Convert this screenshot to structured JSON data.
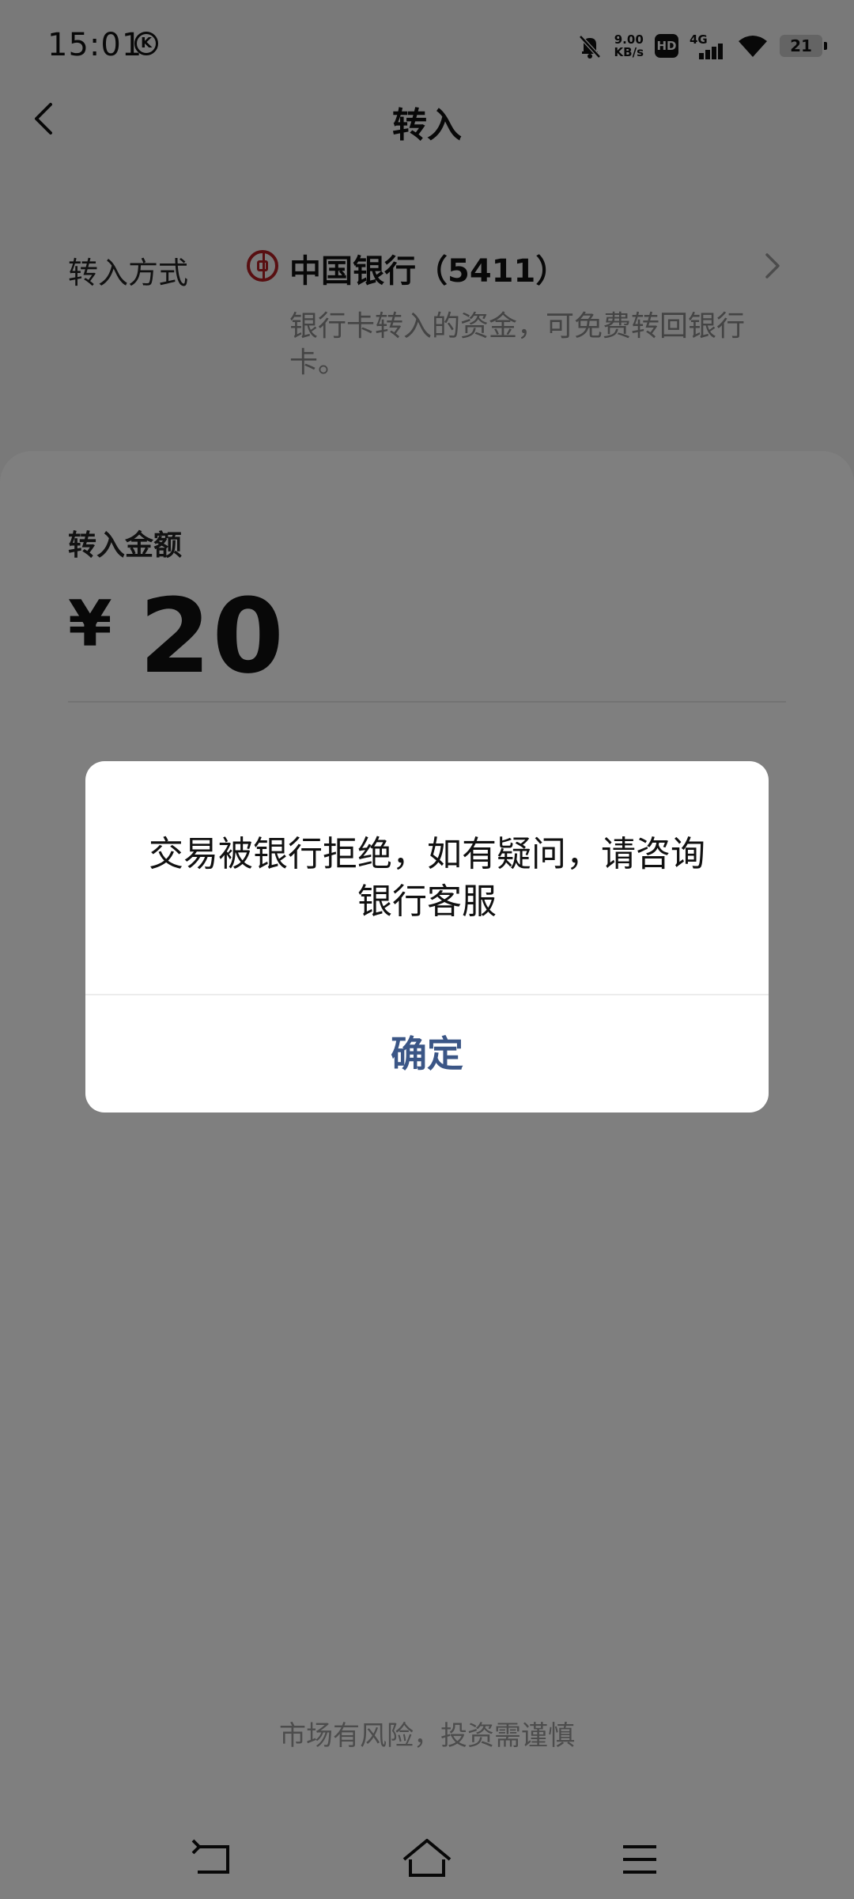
{
  "status_bar": {
    "time": "15:01",
    "k_badge": "K",
    "net_speed_value": "9.00",
    "net_speed_unit": "KB/s",
    "hd": "HD",
    "network": "4G",
    "battery": "21"
  },
  "header": {
    "title": "转入"
  },
  "method": {
    "label": "转入方式",
    "bank": "中国银行（5411）",
    "note": "银行卡转入的资金，可免费转回银行卡。"
  },
  "amount": {
    "label": "转入金额",
    "currency": "¥",
    "value": "20"
  },
  "footer": {
    "risk_notice": "市场有风险，投资需谨慎"
  },
  "dialog": {
    "message": "交易被银行拒绝，如有疑问，请咨询银行客服",
    "confirm_label": "确定"
  },
  "icons": [
    "back-icon",
    "bank-logo-icon",
    "chevron-right-icon",
    "nav-back-icon",
    "nav-home-icon",
    "nav-menu-icon"
  ],
  "colors": {
    "dialog_button": "#3b5686",
    "bank_logo": "#b01e23"
  }
}
